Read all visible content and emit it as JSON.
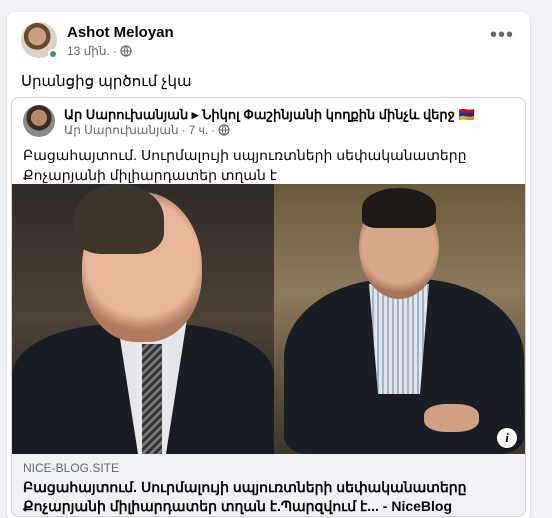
{
  "post": {
    "author": "Ashot Meloyan",
    "time": "13 մին.",
    "text": "Սրանցից պրծում չկա",
    "more_icon": "more-dots-icon",
    "audience_icon": "globe-icon"
  },
  "shared_post": {
    "title": "Ար Սարուխանյան ▸ Նիկոլ Փաշինյանի կողքին մինչև վերջ 🇦🇲",
    "author": "Ար Սարուխանյան",
    "time": "7 ч.",
    "text": "Բացահայտում. Սուրմալույի սպյուռտների սեփականատերը Քոչարյանի միլիարդատեր տղան է"
  },
  "link_preview": {
    "domain": "NICE-BLOG.SITE",
    "title": "Բացահայտում. Սուրմալույի սպյուռտների սեփականատերը Քոչարյանի միլիարդատեր տղան է.Պարզվում է... - NiceBlog",
    "info_label": "i"
  },
  "colors": {
    "page_bg": "#f0f2f5",
    "secondary_text": "#65676b",
    "online": "#31a24c"
  }
}
